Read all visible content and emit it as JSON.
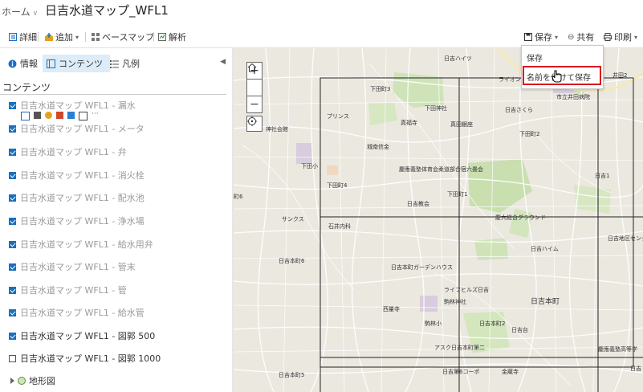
{
  "header": {
    "home_label": "ホーム",
    "home_caret": "∨",
    "title": "日吉水道マップ_WFL1"
  },
  "toolbar": {
    "details_label": "詳細",
    "add_label": "追加",
    "basemap_label": "ベースマップ",
    "analysis_label": "解析",
    "save_label": "保存",
    "share_label": "共有",
    "print_label": "印刷"
  },
  "save_menu": {
    "items": [
      "保存",
      "名前を付けて保存"
    ],
    "highlighted_index": 1
  },
  "panel": {
    "tabs": [
      {
        "label": "情報",
        "active": false
      },
      {
        "label": "コンテンツ",
        "active": true
      },
      {
        "label": "凡例",
        "active": false
      }
    ],
    "heading": "コンテンツ",
    "layers": [
      {
        "label": "日吉水道マップ WFL1 - 漏水",
        "checked": true,
        "dim": true
      },
      {
        "label": "日吉水道マップ WFL1 - メータ",
        "checked": true,
        "dim": true
      },
      {
        "label": "日吉水道マップ WFL1 - 弁",
        "checked": true,
        "dim": true
      },
      {
        "label": "日吉水道マップ WFL1 - 消火栓",
        "checked": true,
        "dim": true
      },
      {
        "label": "日吉水道マップ WFL1 - 配水池",
        "checked": true,
        "dim": true
      },
      {
        "label": "日吉水道マップ WFL1 - 浄水場",
        "checked": true,
        "dim": true
      },
      {
        "label": "日吉水道マップ WFL1 - 給水用弁",
        "checked": true,
        "dim": true
      },
      {
        "label": "日吉水道マップ WFL1 - 管末",
        "checked": true,
        "dim": true
      },
      {
        "label": "日吉水道マップ WFL1 - 管",
        "checked": true,
        "dim": true
      },
      {
        "label": "日吉水道マップ WFL1 - 給水管",
        "checked": true,
        "dim": true
      },
      {
        "label": "日吉水道マップ WFL1 - 図郭 500",
        "checked": true,
        "dim": false
      },
      {
        "label": "日吉水道マップ WFL1 - 図郭 1000",
        "checked": false,
        "dim": false
      }
    ],
    "basemap_label": "地形図"
  },
  "map": {
    "zoom_in": "+",
    "zoom_out": "−",
    "labels": [
      "日吉ハイツ",
      "ライオンズ",
      "井田2",
      "市立井田病院",
      "下田町3",
      "下田神社",
      "日吉さくら",
      "プリンス",
      "真福寺",
      "真田銀座",
      "下田町2",
      "神社会館",
      "城南信金",
      "慶應義塾体育会柔道部合宿六畳会",
      "日吉1",
      "下田小",
      "下田町4",
      "下田町1",
      "日吉教会",
      "慶大総合グラウンド",
      "町6",
      "サンクス",
      "石井内科",
      "日吉地区センタ",
      "日吉ハイム",
      "日吉本町6",
      "日吉本町ガーデンハウス",
      "ライフヒルズ日吉",
      "駒林神社",
      "日吉本町",
      "西量寺",
      "駒林小",
      "日吉本町2",
      "日吉台",
      "アスク日吉本町第二",
      "慶應義塾高等学",
      "日吉本町5",
      "日吉第6コーポ",
      "金蔵寺",
      "日吉"
    ]
  },
  "colors": {
    "accent": "#1a6fc0",
    "tab_active_bg": "#dcecf8",
    "highlight_border": "#d9181f",
    "map_bg": "#ebe8e0",
    "park_green": "#c9dfb0",
    "grid_line": "#222222"
  }
}
